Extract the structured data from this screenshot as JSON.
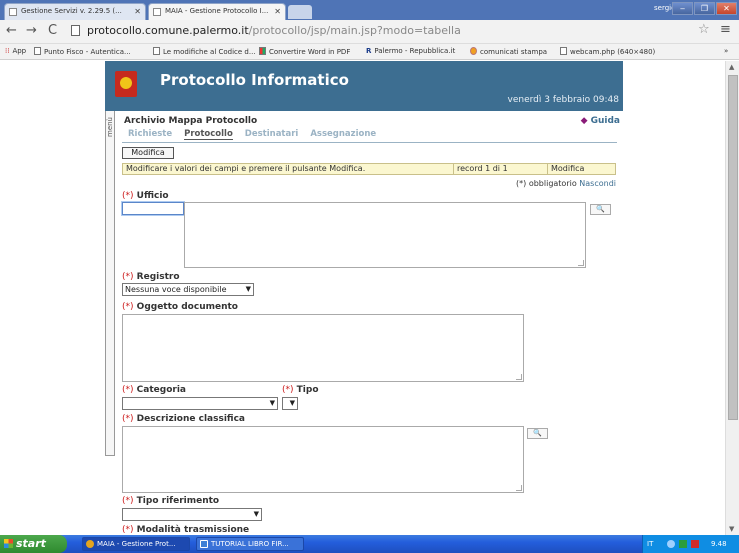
{
  "browser": {
    "tabs": [
      {
        "title": "Gestione Servizi v. 2.29.5 (..."
      },
      {
        "title": "MAIA - Gestione Protocollo I..."
      }
    ],
    "user": "sergio",
    "window_buttons": [
      "‒",
      "❐",
      "✕"
    ],
    "url_host": "protocollo.comune.palermo.it",
    "url_path": "/protocollo/jsp/main.jsp?modo=tabella",
    "bookmarks": [
      "App",
      "Punto Fisco - Autentica...",
      "Le modifiche al Codice d...",
      "Convertire Word in PDF",
      "Palermo - Repubblica.it",
      "comunicati stampa",
      "webcam.php (640×480)"
    ],
    "bookmarks_more": "»"
  },
  "app": {
    "title": "Protocollo Informatico",
    "date": "venerdì 3 febbraio 09:48",
    "side_menu": "menù",
    "section_title": "Archivio Mappa Protocollo",
    "help": "Guida",
    "subtabs": [
      "Richieste",
      "Protocollo",
      "Destinatari",
      "Assegnazione"
    ],
    "modify_button": "Modifica",
    "info": {
      "message": "Modificare i valori dei campi e premere il pulsante Modifica.",
      "record": "record 1 di 1",
      "mode": "Modifica"
    },
    "required_note": "(*) obbligatorio",
    "hide_link": "Nascondi",
    "required_mark": "(*)",
    "fields": {
      "ufficio": "Ufficio",
      "registro": "Registro",
      "registro_value": "Nessuna voce disponibile",
      "oggetto": "Oggetto documento",
      "categoria": "Categoria",
      "tipo": "Tipo",
      "descrizione": "Descrizione classifica",
      "tipo_riferimento": "Tipo riferimento",
      "modalita": "Modalità trasmissione"
    },
    "lookup_icon": "🔍"
  },
  "taskbar": {
    "start": "start",
    "tasks": [
      "MAIA - Gestione Prot...",
      "TUTORIAL LIBRO FIR..."
    ],
    "lang": "IT",
    "time": "9.48"
  }
}
